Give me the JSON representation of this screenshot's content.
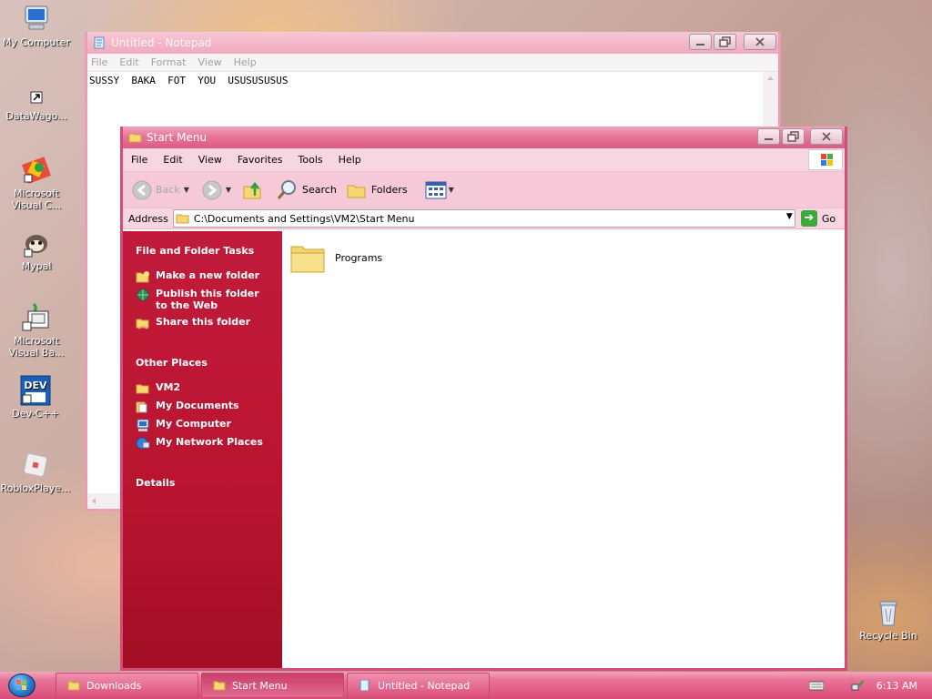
{
  "desktop": {
    "icons": [
      {
        "label": "My Computer"
      },
      {
        "label": "DataWago..."
      },
      {
        "label": "Microsoft Visual C..."
      },
      {
        "label": "Mypal"
      },
      {
        "label": "Microsoft Visual Ba..."
      },
      {
        "label": "Dev-C++"
      },
      {
        "label": "RobloxPlaye..."
      },
      {
        "label": "Recycle Bin"
      }
    ]
  },
  "notepad": {
    "title": "Untitled - Notepad",
    "menu": [
      "File",
      "Edit",
      "Format",
      "View",
      "Help"
    ],
    "text": "SUSSY  BAKA  FOT  YOU  USUSUSUSUS"
  },
  "explorer": {
    "title": "Start Menu",
    "menu": [
      "File",
      "Edit",
      "View",
      "Favorites",
      "Tools",
      "Help"
    ],
    "toolbar": {
      "back": "Back",
      "search": "Search",
      "folders": "Folders"
    },
    "address": {
      "label": "Address",
      "value": "C:\\Documents and Settings\\VM2\\Start Menu",
      "go": "Go"
    },
    "tasks": {
      "header": "File and Folder Tasks",
      "items": [
        "Make a new folder",
        "Publish this folder to the Web",
        "Share this folder"
      ]
    },
    "other_places": {
      "header": "Other Places",
      "items": [
        "VM2",
        "My Documents",
        "My Computer",
        "My Network Places"
      ]
    },
    "details": {
      "header": "Details"
    },
    "files": [
      {
        "name": "Programs"
      }
    ]
  },
  "taskbar": {
    "tasks": [
      {
        "label": "Downloads"
      },
      {
        "label": "Start Menu"
      },
      {
        "label": "Untitled - Notepad"
      }
    ],
    "clock": "6:13 AM"
  }
}
